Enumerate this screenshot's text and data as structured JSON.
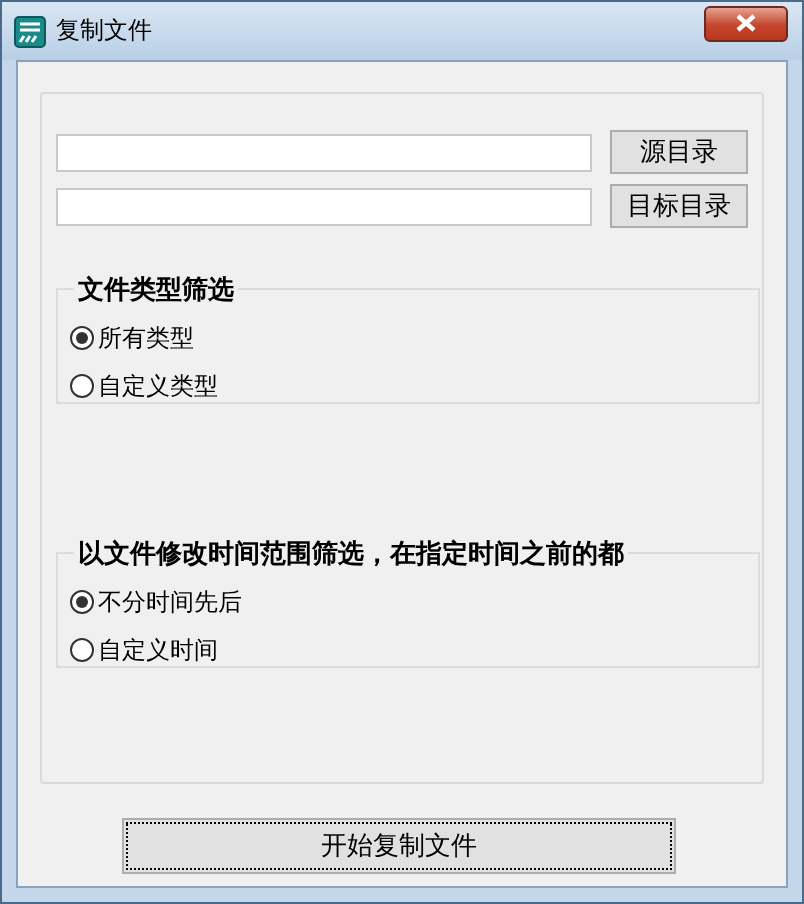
{
  "window": {
    "title": "复制文件"
  },
  "directory_rows": [
    {
      "button": "源目录"
    },
    {
      "button": "目标目录"
    }
  ],
  "groups": [
    {
      "title": "文件类型筛选",
      "options": [
        {
          "label": "所有类型",
          "selected": true
        },
        {
          "label": "自定义类型",
          "selected": false
        }
      ]
    },
    {
      "title": "以文件修改时间范围筛选，在指定时间之前的都",
      "options": [
        {
          "label": "不分时间先后",
          "selected": true
        },
        {
          "label": "自定义时间",
          "selected": false
        }
      ]
    }
  ],
  "start_button": "开始复制文件"
}
